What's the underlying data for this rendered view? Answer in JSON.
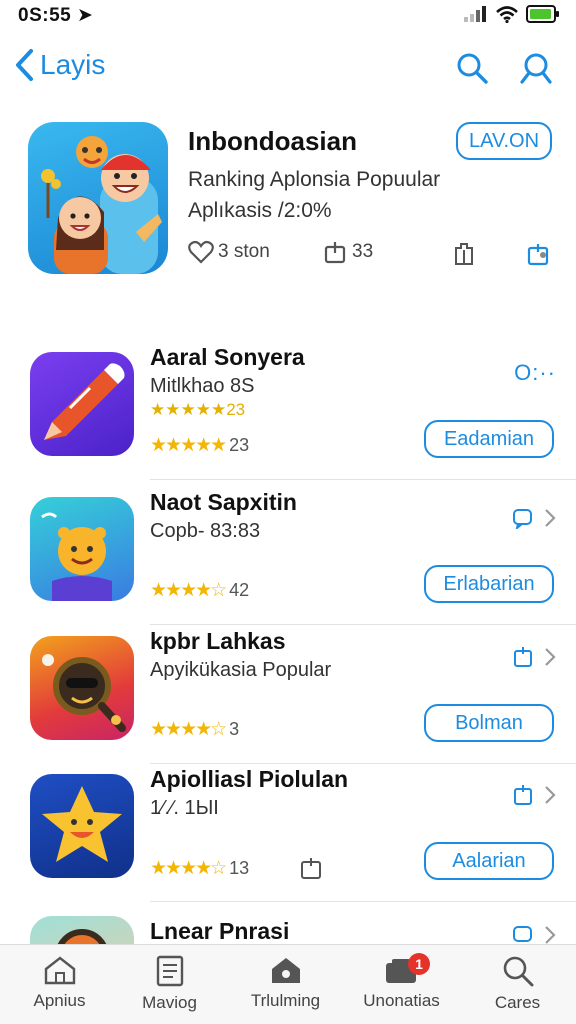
{
  "status": {
    "time": "0S:55 ➤"
  },
  "nav": {
    "back_label": "Layis"
  },
  "featured": {
    "title": "Inbondoasian",
    "subtitle": "Ranking Aplonsia Popuular",
    "detail": "Aplıkasis /2:0%",
    "action_label": "LAV.ON",
    "likes": "3 ston",
    "shares": "33"
  },
  "apps": [
    {
      "name": "Aaral Sonyera",
      "sub": "Mitlkhao 8S",
      "sub2": "★★★★★23",
      "stars": "★★★★★",
      "rating": "23",
      "button": "Eadamian"
    },
    {
      "name": "Naot Sapxitin",
      "sub": "Copb- 83:83",
      "stars": "★★★★☆",
      "rating": "42",
      "button": "Erlabarian"
    },
    {
      "name": "kpbr Lahkas",
      "sub": "Apyikükasia Popular",
      "stars": "★★★★☆",
      "rating": "3",
      "button": "Bolman"
    },
    {
      "name": "Apiolliasl Piolulan",
      "sub": "1⁄.∕. 1ЫI",
      "stars": "★★★★☆",
      "rating": "13",
      "button": "Aalarian"
    },
    {
      "name": "Lnear Pnrasi"
    }
  ],
  "tabs": [
    {
      "label": "Apnius"
    },
    {
      "label": "Maviog"
    },
    {
      "label": "Trlulming"
    },
    {
      "label": "Unonatias",
      "badge": "1"
    },
    {
      "label": "Cares"
    }
  ],
  "colors": {
    "accent": "#1d8ce0",
    "star": "#f2b705",
    "badge": "#e5332a"
  }
}
